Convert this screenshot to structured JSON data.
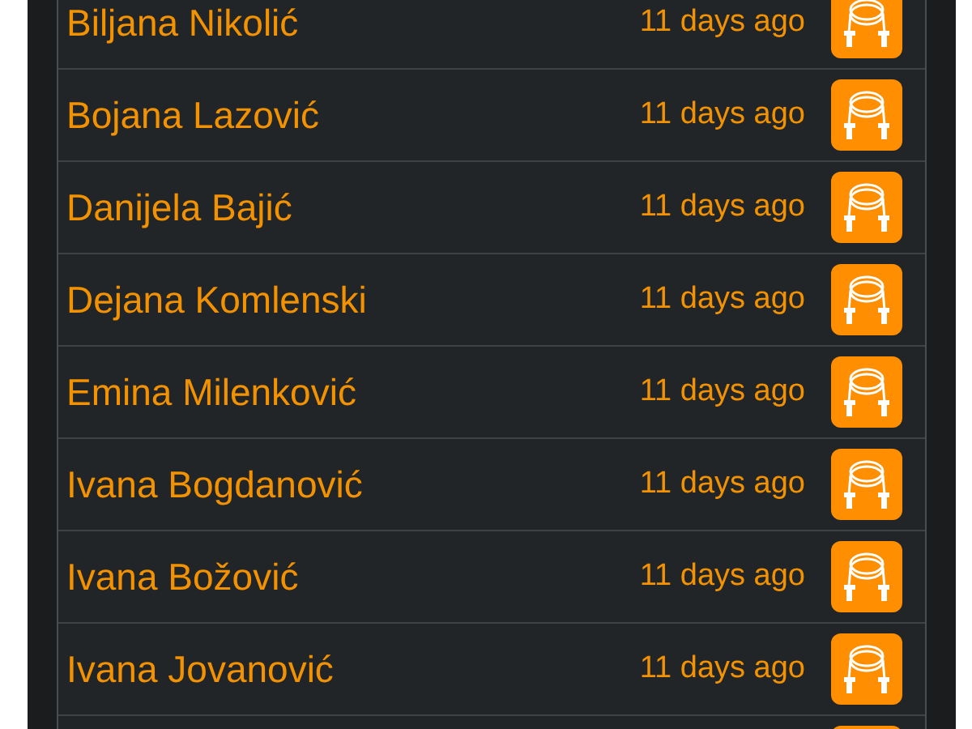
{
  "rows": [
    {
      "kind": "entry",
      "name": "Biljana Nikolić",
      "time": "11 days ago"
    },
    {
      "kind": "entry",
      "name": "Bojana Lazović",
      "time": "11 days ago"
    },
    {
      "kind": "entry",
      "name": "Danijela Bajić",
      "time": "11 days ago"
    },
    {
      "kind": "entry",
      "name": "Dejana Komlenski",
      "time": "11 days ago"
    },
    {
      "kind": "entry",
      "name": "Emina Milenković",
      "time": "11 days ago"
    },
    {
      "kind": "entry",
      "name": "Ivana Bogdanović",
      "time": "11 days ago"
    },
    {
      "kind": "entry",
      "name": "Ivana Božović",
      "time": "11 days ago"
    },
    {
      "kind": "entry",
      "name": "Ivana Jovanović",
      "time": "11 days ago"
    },
    {
      "kind": "icon-only"
    }
  ]
}
